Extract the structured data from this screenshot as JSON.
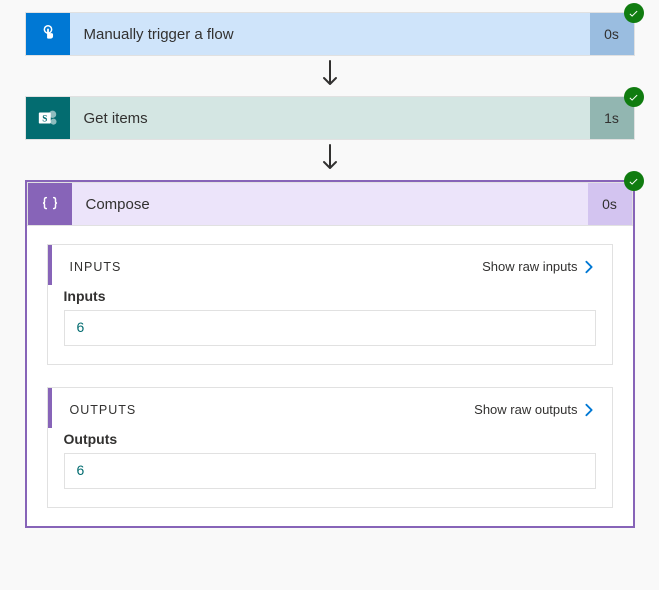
{
  "steps": {
    "trigger": {
      "title": "Manually trigger a flow",
      "duration": "0s"
    },
    "getitems": {
      "title": "Get items",
      "duration": "1s"
    },
    "compose": {
      "title": "Compose",
      "duration": "0s"
    }
  },
  "panels": {
    "inputs": {
      "headerTitle": "INPUTS",
      "showRawLabel": "Show raw inputs",
      "subLabel": "Inputs",
      "value": "6"
    },
    "outputs": {
      "headerTitle": "OUTPUTS",
      "showRawLabel": "Show raw outputs",
      "subLabel": "Outputs",
      "value": "6"
    }
  }
}
